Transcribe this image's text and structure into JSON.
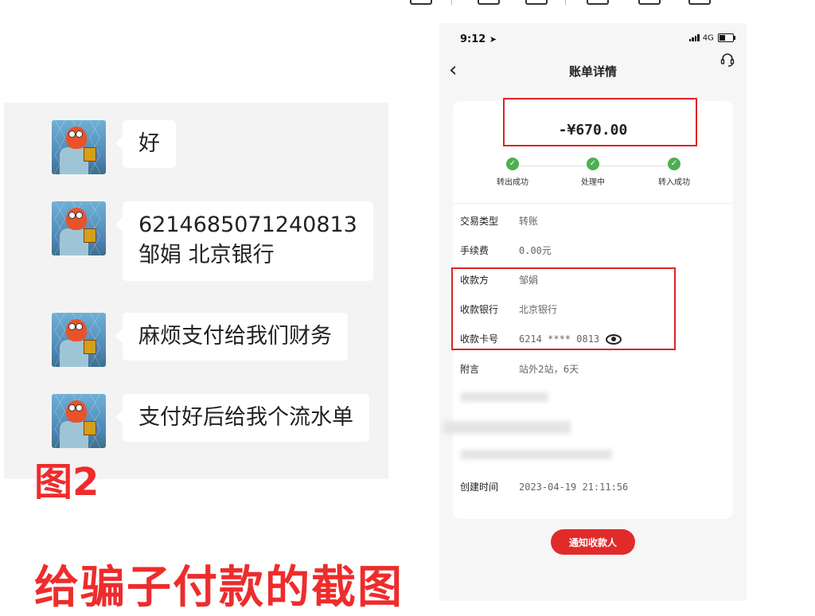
{
  "chat": {
    "messages": [
      {
        "text": "好"
      },
      {
        "line1": "6214685071240813",
        "line2": "邹娟 北京银行"
      },
      {
        "text": "麻烦支付给我们财务"
      },
      {
        "text": "支付好后给我个流水单"
      }
    ],
    "figure_label": "图2"
  },
  "caption": "给骗子付款的截图",
  "phone": {
    "status_time": "9:12",
    "status_network": "4G",
    "nav_title": "账单详情",
    "back_glyph": "‹",
    "amount": "-¥670.00",
    "steps": [
      {
        "label": "转出成功"
      },
      {
        "label": "处理中"
      },
      {
        "label": "转入成功"
      }
    ],
    "details": {
      "type": {
        "label": "交易类型",
        "value": "转账"
      },
      "fee": {
        "label": "手续费",
        "value": "0.00元"
      },
      "payee": {
        "label": "收款方",
        "value": "邹娟"
      },
      "bank": {
        "label": "收款银行",
        "value": "北京银行"
      },
      "card": {
        "label": "收款卡号",
        "value": "6214 **** 0813"
      },
      "note": {
        "label": "附言",
        "value": "站外2站，6天"
      },
      "created": {
        "label": "创建时间",
        "value": "2023-04-19 21:11:56"
      }
    },
    "notify_button": "通知收款人"
  },
  "colors": {
    "accent_red": "#e02323",
    "success_green": "#4caf50"
  }
}
